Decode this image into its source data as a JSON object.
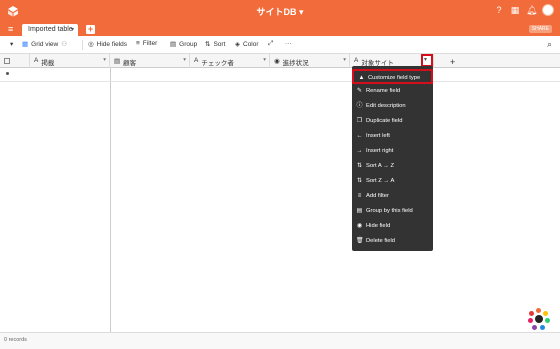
{
  "topbar": {
    "base_title": "サイトDB ▾"
  },
  "tabbar": {
    "active_tab": "Imported table",
    "share_label": "SHARE"
  },
  "toolbar": {
    "view_label": "Grid view",
    "hide_fields": "Hide fields",
    "filter": "Filter",
    "group": "Group",
    "sort": "Sort",
    "color": "Color",
    "more": "···"
  },
  "columns": [
    {
      "label": "掲載"
    },
    {
      "label": "顧客"
    },
    {
      "label": "チェック者"
    },
    {
      "label": "進捗状況"
    },
    {
      "label": "対象サイト"
    }
  ],
  "add_column": "+",
  "menu": {
    "items": [
      {
        "label": "Customize field type",
        "icon": "shapes-icon"
      },
      {
        "label": "Rename field",
        "icon": "pencil-icon"
      },
      {
        "label": "Edit description",
        "icon": "info-icon"
      },
      {
        "label": "Duplicate field",
        "icon": "duplicate-icon"
      },
      {
        "label": "Insert left",
        "icon": "arrow-left-icon"
      },
      {
        "label": "Insert right",
        "icon": "arrow-right-icon"
      },
      {
        "label": "Sort A → Z",
        "icon": "sort-asc-icon"
      },
      {
        "label": "Sort Z → A",
        "icon": "sort-desc-icon"
      },
      {
        "label": "Add filter",
        "icon": "filter-icon"
      },
      {
        "label": "Group by this field",
        "icon": "group-icon"
      },
      {
        "label": "Hide field",
        "icon": "eye-icon"
      },
      {
        "label": "Delete field",
        "icon": "trash-icon"
      }
    ]
  },
  "footer": {
    "record_count": "0 records"
  },
  "colors": {
    "brand": "#f26b3a",
    "highlight": "#d40f1b",
    "menu_bg": "#333333"
  }
}
